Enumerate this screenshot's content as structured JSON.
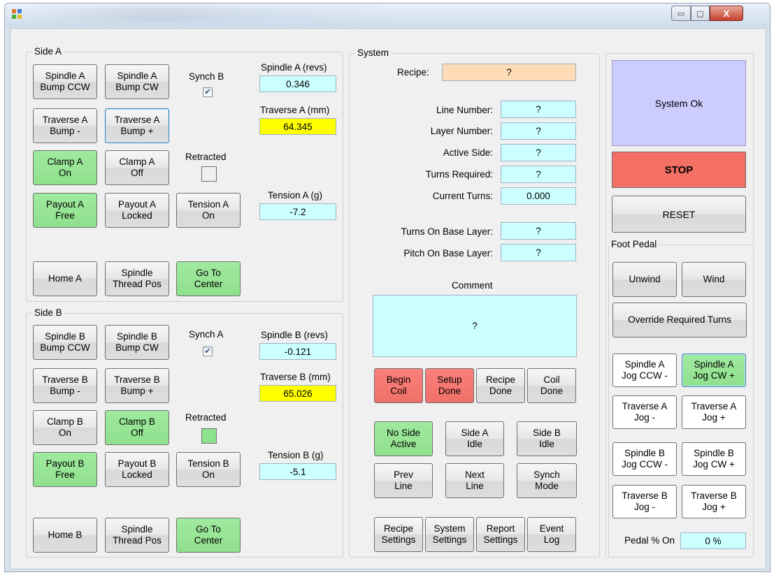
{
  "window": {
    "minimize_glyph": "▭",
    "maximize_glyph": "▢",
    "close_glyph": "X"
  },
  "side_a": {
    "title": "Side A",
    "spindle_bump_ccw": "Spindle A\nBump CCW",
    "spindle_bump_cw": "Spindle A\nBump CW",
    "synch_label": "Synch B",
    "synch_checked": true,
    "spindle_revs_label": "Spindle A (revs)",
    "spindle_revs_value": "0.346",
    "traverse_bump_minus": "Traverse A\nBump -",
    "traverse_bump_plus": "Traverse A\nBump +",
    "traverse_mm_label": "Traverse A (mm)",
    "traverse_mm_value": "64.345",
    "clamp_on": "Clamp A\nOn",
    "clamp_off": "Clamp A\nOff",
    "retracted_label": "Retracted",
    "retracted_on": false,
    "payout_free": "Payout A\nFree",
    "payout_locked": "Payout A\nLocked",
    "tension_on": "Tension A\nOn",
    "tension_label": "Tension A (g)",
    "tension_value": "-7.2",
    "home": "Home A",
    "spindle_thread_pos": "Spindle\nThread Pos",
    "go_to_center": "Go To\nCenter"
  },
  "side_b": {
    "title": "Side B",
    "spindle_bump_ccw": "Spindle B\nBump CCW",
    "spindle_bump_cw": "Spindle B\nBump CW",
    "synch_label": "Synch A",
    "synch_checked": true,
    "spindle_revs_label": "Spindle B (revs)",
    "spindle_revs_value": "-0.121",
    "traverse_bump_minus": "Traverse B\nBump -",
    "traverse_bump_plus": "Traverse B\nBump +",
    "traverse_mm_label": "Traverse B (mm)",
    "traverse_mm_value": "65.026",
    "clamp_on": "Clamp B\nOn",
    "clamp_off": "Clamp B\nOff",
    "retracted_label": "Retracted",
    "retracted_on": true,
    "payout_free": "Payout B\nFree",
    "payout_locked": "Payout B\nLocked",
    "tension_on": "Tension B\nOn",
    "tension_label": "Tension B (g)",
    "tension_value": "-5.1",
    "home": "Home B",
    "spindle_thread_pos": "Spindle\nThread Pos",
    "go_to_center": "Go To\nCenter"
  },
  "system": {
    "title": "System",
    "recipe_label": "Recipe:",
    "recipe_value": "?",
    "line_number_label": "Line Number:",
    "line_number_value": "?",
    "layer_number_label": "Layer Number:",
    "layer_number_value": "?",
    "active_side_label": "Active Side:",
    "active_side_value": "?",
    "turns_required_label": "Turns Required:",
    "turns_required_value": "?",
    "current_turns_label": "Current Turns:",
    "current_turns_value": "0.000",
    "turns_on_base_label": "Turns On Base Layer:",
    "turns_on_base_value": "?",
    "pitch_on_base_label": "Pitch On Base Layer:",
    "pitch_on_base_value": "?",
    "comment_label": "Comment",
    "comment_value": "?",
    "begin_coil": "Begin\nCoil",
    "setup_done": "Setup\nDone",
    "recipe_done": "Recipe\nDone",
    "coil_done": "Coil\nDone",
    "no_side_active": "No Side\nActive",
    "side_a_idle": "Side A\nIdle",
    "side_b_idle": "Side B\nIdle",
    "prev_line": "Prev\nLine",
    "next_line": "Next\nLine",
    "synch_mode": "Synch\nMode",
    "recipe_settings": "Recipe\nSettings",
    "system_settings": "System\nSettings",
    "report_settings": "Report\nSettings",
    "event_log": "Event\nLog"
  },
  "status": {
    "text": "System Ok",
    "stop": "STOP",
    "reset": "RESET"
  },
  "foot_pedal": {
    "title": "Foot Pedal",
    "unwind": "Unwind",
    "wind": "Wind",
    "override_required_turns": "Override Required Turns",
    "spindle_a_jog_ccw": "Spindle A\nJog CCW -",
    "spindle_a_jog_cw": "Spindle A\nJog CW +",
    "traverse_a_jog_minus": "Traverse A\nJog -",
    "traverse_a_jog_plus": "Traverse A\nJog +",
    "spindle_b_jog_ccw": "Spindle B\nJog CCW -",
    "spindle_b_jog_cw": "Spindle B\nJog CW +",
    "traverse_b_jog_minus": "Traverse B\nJog -",
    "traverse_b_jog_plus": "Traverse B\nJog +",
    "pedal_label": "Pedal % On",
    "pedal_value": "0 %"
  },
  "colors": {
    "active_green": "#8fe08d",
    "alert_red": "#f07068",
    "status_blue": "#ccccff",
    "value_cyan": "#ccffff",
    "value_yellow": "#ffff00",
    "recipe_orange": "#ffdcb8"
  }
}
